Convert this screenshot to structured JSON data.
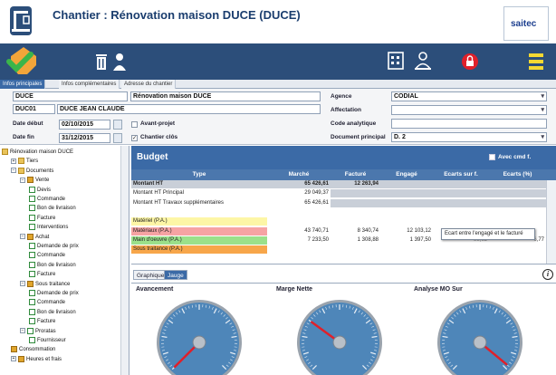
{
  "header": {
    "title": "Chantier : Rénovation maison DUCE (DUCE)",
    "logo_text": "saitec",
    "brand_color": "#2c4e7a"
  },
  "toolbar": {
    "icons": [
      "check-arrow-icon",
      "trash-icon",
      "users-icon",
      "building-icon",
      "team-icon",
      "lock-icon",
      "menu-icon"
    ]
  },
  "tabs": [
    "Infos principales",
    "Infos complémentaires",
    "Adresse du chantier"
  ],
  "form": {
    "code": "DUCE",
    "name": "Rénovation maison DUCE",
    "client_code": "DUC01",
    "client_name": "DUCE JEAN CLAUDE",
    "date_debut_label": "Date début",
    "date_debut": "02/10/2015",
    "date_fin_label": "Date fin",
    "date_fin": "31/12/2015",
    "avant_projet_label": "Avant-projet",
    "chantier_clos_label": "Chantier clôs",
    "agence_label": "Agence",
    "agence": "CODIAL",
    "affectation_label": "Affectation",
    "affectation": "",
    "code_analytique_label": "Code analytique",
    "code_analytique": "",
    "doc_principal_label": "Document principal",
    "doc_principal": "D. 2"
  },
  "tree": [
    {
      "label": "Rénovation maison DUCE",
      "type": "folder",
      "level": 0
    },
    {
      "label": "Tiers",
      "type": "folder",
      "level": 1,
      "exp": "+"
    },
    {
      "label": "Documents",
      "type": "folder",
      "level": 1,
      "exp": "−"
    },
    {
      "label": "Vente",
      "type": "branch",
      "level": 2,
      "exp": "−"
    },
    {
      "label": "Devis",
      "type": "doc",
      "level": 3
    },
    {
      "label": "Commande",
      "type": "doc",
      "level": 3
    },
    {
      "label": "Bon de livraison",
      "type": "doc",
      "level": 3
    },
    {
      "label": "Facture",
      "type": "doc",
      "level": 3
    },
    {
      "label": "Interventions",
      "type": "doc",
      "level": 3
    },
    {
      "label": "Achat",
      "type": "branch",
      "level": 2,
      "exp": "−"
    },
    {
      "label": "Demande de prix",
      "type": "doc",
      "level": 3
    },
    {
      "label": "Commande",
      "type": "doc",
      "level": 3
    },
    {
      "label": "Bon de livraison",
      "type": "doc",
      "level": 3
    },
    {
      "label": "Facture",
      "type": "doc",
      "level": 3
    },
    {
      "label": "Sous traitance",
      "type": "branch",
      "level": 2,
      "exp": "−"
    },
    {
      "label": "Demande de prix",
      "type": "doc",
      "level": 3
    },
    {
      "label": "Commande",
      "type": "doc",
      "level": 3
    },
    {
      "label": "Bon de livraison",
      "type": "doc",
      "level": 3
    },
    {
      "label": "Facture",
      "type": "doc",
      "level": 3
    },
    {
      "label": "Proratas",
      "type": "doc",
      "level": 2,
      "exp": "−"
    },
    {
      "label": "Fournisseur",
      "type": "doc",
      "level": 3
    },
    {
      "label": "Consommation",
      "type": "branch",
      "level": 1
    },
    {
      "label": "Heures et frais",
      "type": "branch",
      "level": 1,
      "exp": "+"
    }
  ],
  "budget": {
    "title": "Budget",
    "avec_cmd_label": "Avec cmd f.",
    "columns": [
      "Type",
      "Marché",
      "Facturé",
      "Engagé",
      "Ecarts sur f.",
      "Ecarts (%)"
    ],
    "rows": [
      {
        "type": "Montant HT",
        "marche": "65 426,61",
        "facture": "12 263,94",
        "engage": "",
        "ecart": "",
        "pct": "",
        "bold": true,
        "bg": "#c9cfd8"
      },
      {
        "type": "Montant HT Principal",
        "marche": "29 049,37",
        "facture": "",
        "engage": "",
        "ecart": "",
        "pct": "",
        "bg": "#ffffff"
      },
      {
        "type": "Montant HT Travaux supplémentaires",
        "marche": "65 426,61",
        "facture": "",
        "engage": "",
        "ecart": "",
        "pct": "",
        "bg": "#ffffff"
      },
      {
        "type": "",
        "marche": "",
        "facture": "",
        "engage": "",
        "ecart": "",
        "pct": "",
        "bg": "#ffffff"
      },
      {
        "type": "Matériel (P.A.)",
        "marche": "",
        "facture": "",
        "engage": "",
        "ecart": "",
        "pct": "",
        "bg": "#fdf6a6"
      },
      {
        "type": "Matériaux (P.A.)",
        "marche": "43 740,71",
        "facture": "8 340,74",
        "engage": "12 103,12",
        "ecart": "",
        "pct": "",
        "bg": "#f6a3a3"
      },
      {
        "type": "Main d'oeuvre (P.A.)",
        "marche": "7 233,50",
        "facture": "1 308,88",
        "engage": "1 397,50",
        "ecart": "-88,62",
        "pct": "-6,77",
        "bg": "#9be08a"
      },
      {
        "type": "Sous traitance (P.A.)",
        "marche": "",
        "facture": "",
        "engage": "",
        "ecart": "",
        "pct": "",
        "bg": "#f7a64a"
      }
    ],
    "tooltip": "Ecart entre l'engagé et le facturé"
  },
  "lower": {
    "tabs": [
      "Graphique",
      "Jauge"
    ],
    "gauges": [
      {
        "title": "Avancement",
        "value": 0.0,
        "scale_max": 100
      },
      {
        "title": "Marge Nette",
        "value": 0.3,
        "scale_max": 100
      },
      {
        "title": "Analyse MO Sur",
        "value": 0.98,
        "scale_max": 100
      }
    ]
  }
}
